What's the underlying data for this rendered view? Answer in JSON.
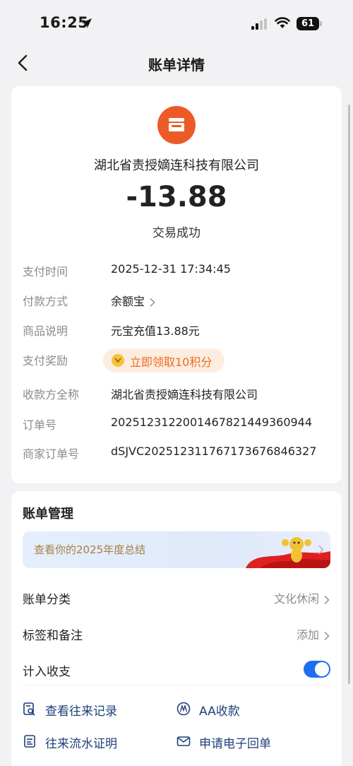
{
  "status_bar": {
    "time": "16:25",
    "battery": "61"
  },
  "nav": {
    "title": "账单详情"
  },
  "transaction": {
    "merchant": "湖北省责授嫡连科技有限公司",
    "amount": "-13.88",
    "status": "交易成功"
  },
  "details": [
    {
      "label": "支付时间",
      "value": "2025-12-31 17:34:45"
    },
    {
      "label": "付款方式",
      "value": "余额宝"
    },
    {
      "label": "商品说明",
      "value": "元宝充值13.88元"
    },
    {
      "label": "支付奖励",
      "value": "立即领取10积分"
    },
    {
      "label": "收款方全称",
      "value": "湖北省责授嫡连科技有限公司"
    },
    {
      "label": "订单号",
      "value": "2025123122001467821449360944"
    },
    {
      "label": "商家订单号",
      "value": "dSJVC2025123117671736768463​27"
    }
  ],
  "management": {
    "title": "账单管理",
    "banner": "查看你的2025年度总结",
    "category_label": "账单分类",
    "category_value": "文化休闲",
    "tags_label": "标签和备注",
    "tags_value": "添加",
    "include_label": "计入收支",
    "include_on": true
  },
  "actions": [
    {
      "label": "查看往来记录",
      "icon": "search-list-icon"
    },
    {
      "label": "AA收款",
      "icon": "aa-icon"
    },
    {
      "label": "往来流水证明",
      "icon": "document-icon"
    },
    {
      "label": "申请电子回单",
      "icon": "mail-icon"
    }
  ],
  "colors": {
    "accent": "#1e6ff0",
    "merchant_icon": "#ec5b27",
    "reward": "#ef6d1f"
  }
}
